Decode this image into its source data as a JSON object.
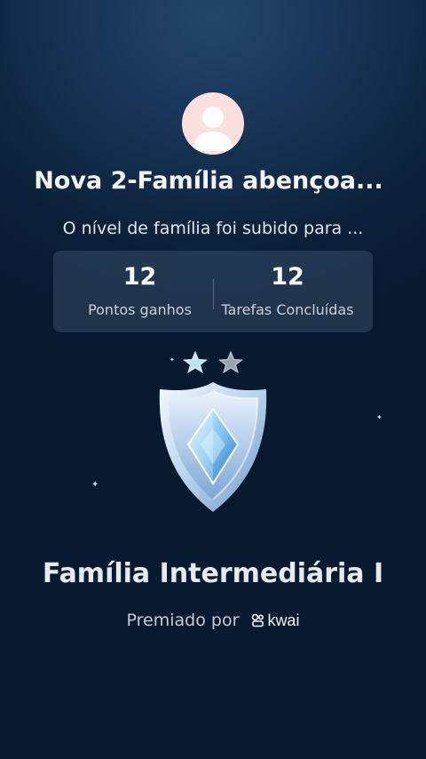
{
  "header": {
    "family_name": "Nova 2-Família abençoa...",
    "level_message": "O nível de família foi subido para ..."
  },
  "stats": [
    {
      "value": "12",
      "label": "Pontos ganhos"
    },
    {
      "value": "12",
      "label": "Tarefas Concluídas"
    }
  ],
  "badge": {
    "stars_filled": 1,
    "stars_total": 2,
    "rank_title": "Família Intermediária I"
  },
  "footer": {
    "awarded_by": "Premiado por",
    "brand": "kwai"
  },
  "icons": [
    "avatar-placeholder-icon",
    "star-icon",
    "shield-badge-icon",
    "sparkle-icon",
    "kwai-logo-icon"
  ],
  "colors": {
    "background": "#0b1f38",
    "avatar_bg": "#fbe0de",
    "star_filled": "#bfe3f7",
    "star_empty": "#9aa3ad"
  }
}
